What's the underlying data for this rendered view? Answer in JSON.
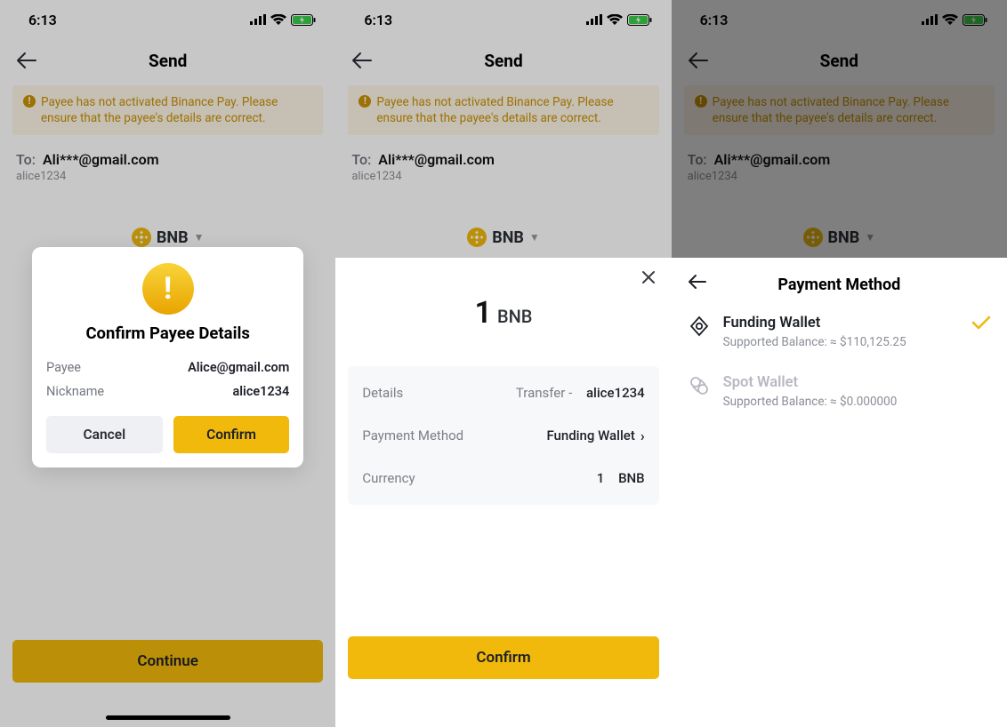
{
  "status": {
    "time": "6:13"
  },
  "header": {
    "title": "Send"
  },
  "warning": "Payee has not activated Binance Pay. Please ensure that the payee's details are correct.",
  "to": {
    "label": "To:",
    "email": "Ali***@gmail.com",
    "nickname": "alice1234"
  },
  "coin": {
    "symbol": "BNB"
  },
  "continue_label": "Continue",
  "modal": {
    "title": "Confirm Payee Details",
    "rows": {
      "payee": {
        "k": "Payee",
        "v": "Alice@gmail.com"
      },
      "nick": {
        "k": "Nickname",
        "v": "alice1234"
      }
    },
    "cancel": "Cancel",
    "confirm": "Confirm"
  },
  "sheet2": {
    "amount": "1",
    "symbol": "BNB",
    "details_label": "Details",
    "details_value_prefix": "Transfer -",
    "details_value_nick": "alice1234",
    "pm_label": "Payment Method",
    "pm_value": "Funding Wallet",
    "currency_label": "Currency",
    "currency_amount": "1",
    "currency_symbol": "BNB",
    "confirm": "Confirm"
  },
  "sheet3": {
    "title": "Payment Method",
    "items": [
      {
        "name": "Funding Wallet",
        "balance": "Supported Balance: ≈ $110,125.25",
        "selected": true
      },
      {
        "name": "Spot Wallet",
        "balance": "Supported Balance: ≈ $0.000000",
        "selected": false
      }
    ]
  }
}
